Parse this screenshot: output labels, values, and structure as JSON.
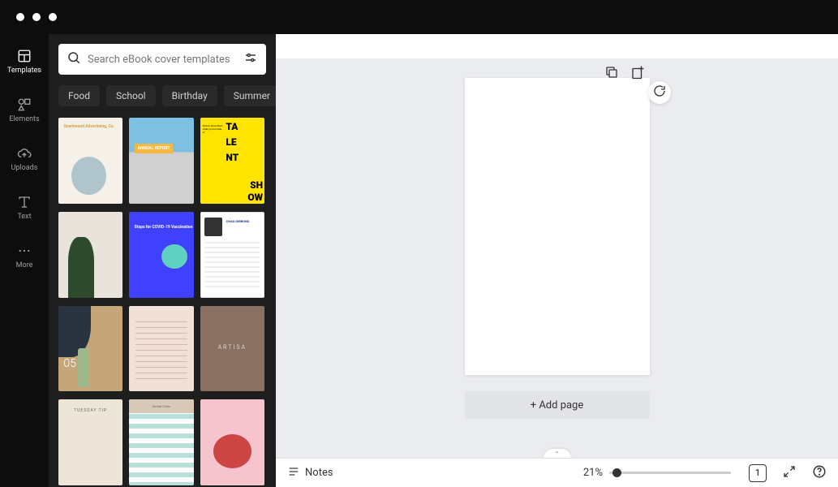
{
  "nav": {
    "items": [
      {
        "label": "Templates"
      },
      {
        "label": "Elements"
      },
      {
        "label": "Uploads"
      },
      {
        "label": "Text"
      },
      {
        "label": "More"
      }
    ]
  },
  "search": {
    "placeholder": "Search eBook cover templates"
  },
  "chips": [
    "Food",
    "School",
    "Birthday",
    "Summer"
  ],
  "templates": {
    "t1_title": "Quarkwood Advertising, Co.",
    "t2_badge": "ANNUAL REPORT",
    "t3_letters": {
      "a": "TA",
      "b": "LE",
      "c": "NT",
      "d": "SH",
      "e": "OW"
    },
    "t3_tag": "time to show them what you're made of",
    "t5_title": "Steps for COVID-19 Vaccination",
    "t6_name": "CHAD GIBBONS",
    "t7_num": "05",
    "t9_text": "ARTISA",
    "t10_title": "TUESDAY TIP",
    "t11_hdr": "Dental Clinic"
  },
  "canvas": {
    "add_page_label": "+ Add page"
  },
  "bottom": {
    "notes_label": "Notes",
    "zoom_label": "21%",
    "page_count": "1"
  }
}
